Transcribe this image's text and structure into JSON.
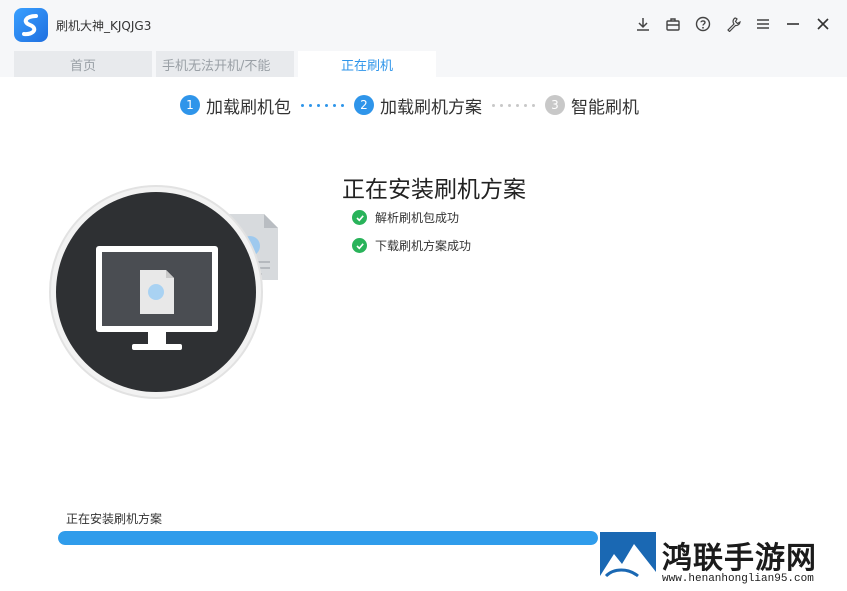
{
  "app": {
    "title": "刷机大神_KJQJG3"
  },
  "titlebar_icons": [
    "download-icon",
    "briefcase-icon",
    "help-icon",
    "wrench-icon",
    "menu-icon",
    "minimize-icon",
    "close-icon"
  ],
  "tabs": [
    {
      "label": "首页"
    },
    {
      "label": "手机无法开机/不能"
    },
    {
      "label": "正在刷机"
    }
  ],
  "steps": [
    {
      "num": "1",
      "label": "加载刷机包",
      "done": true
    },
    {
      "num": "2",
      "label": "加载刷机方案",
      "done": true
    },
    {
      "num": "3",
      "label": "智能刷机",
      "done": false
    }
  ],
  "main": {
    "heading": "正在安装刷机方案",
    "status": [
      {
        "text": "解析刷机包成功"
      },
      {
        "text": "下载刷机方案成功"
      }
    ]
  },
  "progress": {
    "label": "正在安装刷机方案",
    "percent": 100
  },
  "watermark": {
    "title": "鸿联手游网",
    "url": "www.henanhonglian95.com"
  },
  "colors": {
    "accent": "#2f95ea",
    "step_pending": "#c8c8c8",
    "success": "#29b35a",
    "dark_circle": "#2e3033"
  }
}
